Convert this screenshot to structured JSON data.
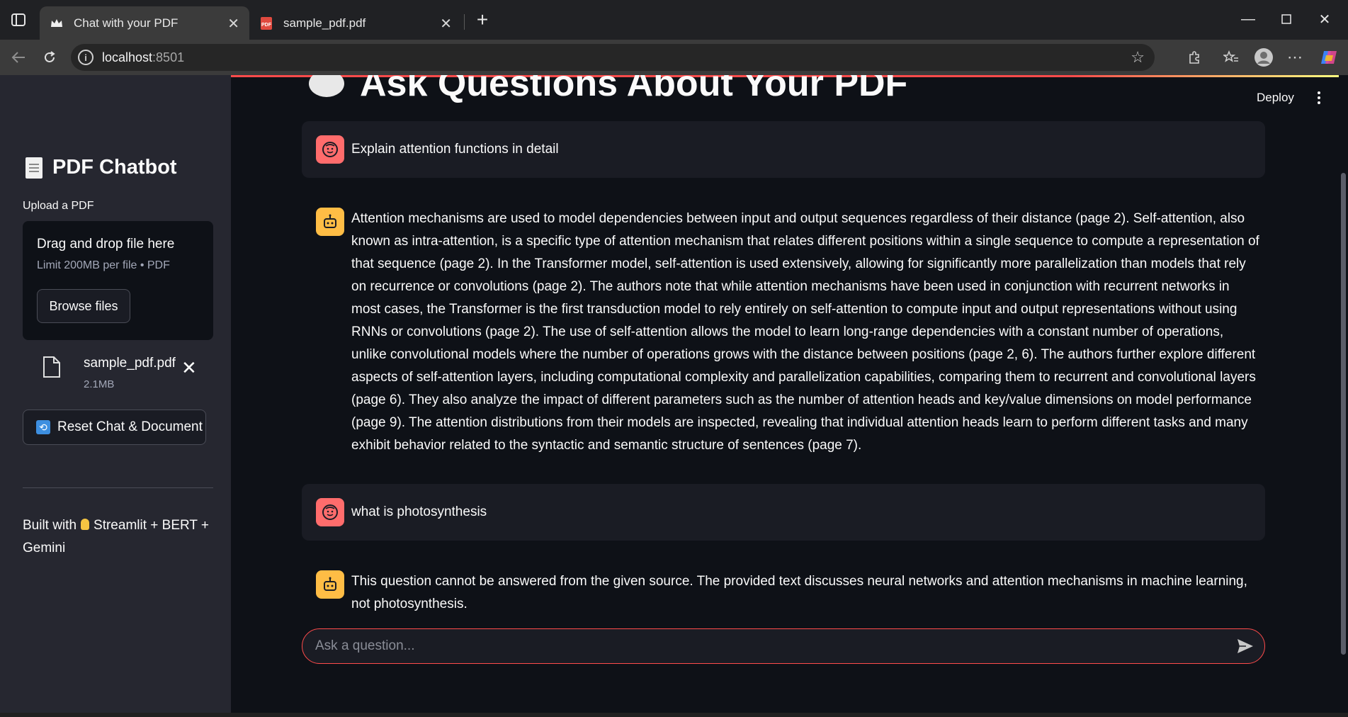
{
  "browser": {
    "tabs": [
      {
        "title": "Chat with your PDF",
        "active": true
      },
      {
        "title": "sample_pdf.pdf",
        "active": false
      }
    ],
    "url_host": "localhost",
    "url_port": ":8501"
  },
  "sidebar": {
    "title": "PDF Chatbot",
    "upload_label": "Upload a PDF",
    "dropzone_title": "Drag and drop file here",
    "dropzone_limit": "Limit 200MB per file • PDF",
    "browse_label": "Browse files",
    "file_name": "sample_pdf.pdf",
    "file_size": "2.1MB",
    "reset_label": "Reset Chat & Document",
    "built_with_prefix": "Built with",
    "built_with_suffix": "Streamlit + BERT + Gemini"
  },
  "header": {
    "title": "Ask Questions About Your PDF",
    "deploy_label": "Deploy"
  },
  "messages": [
    {
      "role": "user",
      "text": "Explain attention functions in detail"
    },
    {
      "role": "assistant",
      "text": "Attention mechanisms are used to model dependencies between input and output sequences regardless of their distance (page 2). Self-attention, also known as intra-attention, is a specific type of attention mechanism that relates different positions within a single sequence to compute a representation of that sequence (page 2). In the Transformer model, self-attention is used extensively, allowing for significantly more parallelization than models that rely on recurrence or convolutions (page 2). The authors note that while attention mechanisms have been used in conjunction with recurrent networks in most cases, the Transformer is the first transduction model to rely entirely on self-attention to compute input and output representations without using RNNs or convolutions (page 2). The use of self-attention allows the model to learn long-range dependencies with a constant number of operations, unlike convolutional models where the number of operations grows with the distance between positions (page 2, 6). The authors further explore different aspects of self-attention layers, including computational complexity and parallelization capabilities, comparing them to recurrent and convolutional layers (page 6). They also analyze the impact of different parameters such as the number of attention heads and key/value dimensions on model performance (page 9). The attention distributions from their models are inspected, revealing that individual attention heads learn to perform different tasks and many exhibit behavior related to the syntactic and semantic structure of sentences (page 7)."
    },
    {
      "role": "user",
      "text": "what is photosynthesis"
    },
    {
      "role": "assistant",
      "text": "This question cannot be answered from the given source. The provided text discusses neural networks and attention mechanisms in machine learning, not photosynthesis."
    }
  ],
  "chat_input": {
    "placeholder": "Ask a question..."
  },
  "colors": {
    "accent": "#ff4b4b",
    "app_bg": "#0e1117",
    "sidebar_bg": "#262730",
    "user_avatar": "#ff6c6c",
    "bot_avatar": "#ffbd45"
  }
}
